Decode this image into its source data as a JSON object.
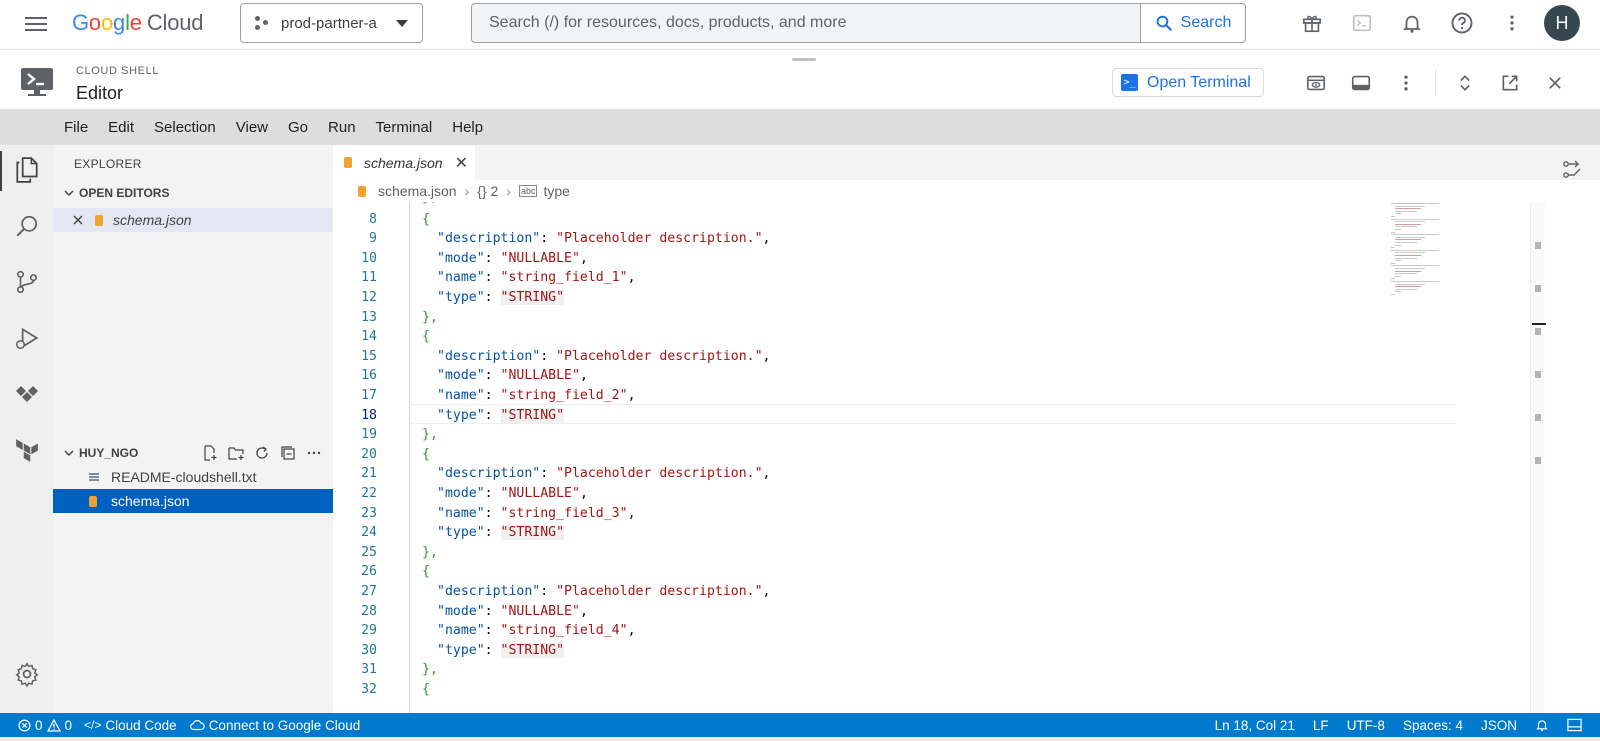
{
  "topbar": {
    "logo_letters": [
      "G",
      "o",
      "o",
      "g",
      "l",
      "e"
    ],
    "logo_cloud": "Cloud",
    "project": "prod-partner-a",
    "search_placeholder": "Search (/) for resources, docs, products, and more",
    "search_button": "Search",
    "avatar_initial": "H"
  },
  "cloudshell": {
    "subtitle": "CLOUD SHELL",
    "title": "Editor",
    "open_terminal": "Open Terminal"
  },
  "menu": [
    "File",
    "Edit",
    "Selection",
    "View",
    "Go",
    "Run",
    "Terminal",
    "Help"
  ],
  "explorer": {
    "title": "EXPLORER",
    "open_editors_label": "OPEN EDITORS",
    "open_editors": [
      {
        "name": "schema.json"
      }
    ],
    "workspace_label": "HUY_NGO",
    "files": [
      {
        "name": "README-cloudshell.txt",
        "type": "txt"
      },
      {
        "name": "schema.json",
        "type": "json"
      }
    ]
  },
  "editor": {
    "tab": "schema.json",
    "breadcrumb": [
      "schema.json",
      "{} 2",
      "type"
    ],
    "current_line": 18,
    "lines": [
      {
        "n": 8,
        "kind": "open"
      },
      {
        "n": 9,
        "kind": "kv",
        "key": "description",
        "value": "Placeholder description.",
        "comma": true
      },
      {
        "n": 10,
        "kind": "kv",
        "key": "mode",
        "value": "NULLABLE",
        "comma": true
      },
      {
        "n": 11,
        "kind": "kv",
        "key": "name",
        "value": "string_field_1",
        "comma": true
      },
      {
        "n": 12,
        "kind": "kv",
        "key": "type",
        "value": "STRING",
        "comma": false,
        "highlight": true
      },
      {
        "n": 13,
        "kind": "close"
      },
      {
        "n": 14,
        "kind": "open"
      },
      {
        "n": 15,
        "kind": "kv",
        "key": "description",
        "value": "Placeholder description.",
        "comma": true
      },
      {
        "n": 16,
        "kind": "kv",
        "key": "mode",
        "value": "NULLABLE",
        "comma": true
      },
      {
        "n": 17,
        "kind": "kv",
        "key": "name",
        "value": "string_field_2",
        "comma": true
      },
      {
        "n": 18,
        "kind": "kv",
        "key": "type",
        "value": "STRING",
        "comma": false,
        "highlight": true
      },
      {
        "n": 19,
        "kind": "close"
      },
      {
        "n": 20,
        "kind": "open"
      },
      {
        "n": 21,
        "kind": "kv",
        "key": "description",
        "value": "Placeholder description.",
        "comma": true
      },
      {
        "n": 22,
        "kind": "kv",
        "key": "mode",
        "value": "NULLABLE",
        "comma": true
      },
      {
        "n": 23,
        "kind": "kv",
        "key": "name",
        "value": "string_field_3",
        "comma": true
      },
      {
        "n": 24,
        "kind": "kv",
        "key": "type",
        "value": "STRING",
        "comma": false,
        "highlight": true
      },
      {
        "n": 25,
        "kind": "close"
      },
      {
        "n": 26,
        "kind": "open"
      },
      {
        "n": 27,
        "kind": "kv",
        "key": "description",
        "value": "Placeholder description.",
        "comma": true
      },
      {
        "n": 28,
        "kind": "kv",
        "key": "mode",
        "value": "NULLABLE",
        "comma": true
      },
      {
        "n": 29,
        "kind": "kv",
        "key": "name",
        "value": "string_field_4",
        "comma": true
      },
      {
        "n": 30,
        "kind": "kv",
        "key": "type",
        "value": "STRING",
        "comma": false,
        "highlight": true
      },
      {
        "n": 31,
        "kind": "close"
      },
      {
        "n": 32,
        "kind": "open"
      }
    ]
  },
  "statusbar": {
    "errors": "0",
    "warnings": "0",
    "cloud_code": "Cloud Code",
    "connect": "Connect to Google Cloud",
    "position": "Ln 18, Col 21",
    "eol": "LF",
    "encoding": "UTF-8",
    "spaces": "Spaces: 4",
    "language": "JSON"
  },
  "colors": {
    "accent": "#1a73e8",
    "statusbar": "#007acc",
    "selection": "#0060c0",
    "json_key": "#0451a5",
    "json_string": "#a31515"
  }
}
